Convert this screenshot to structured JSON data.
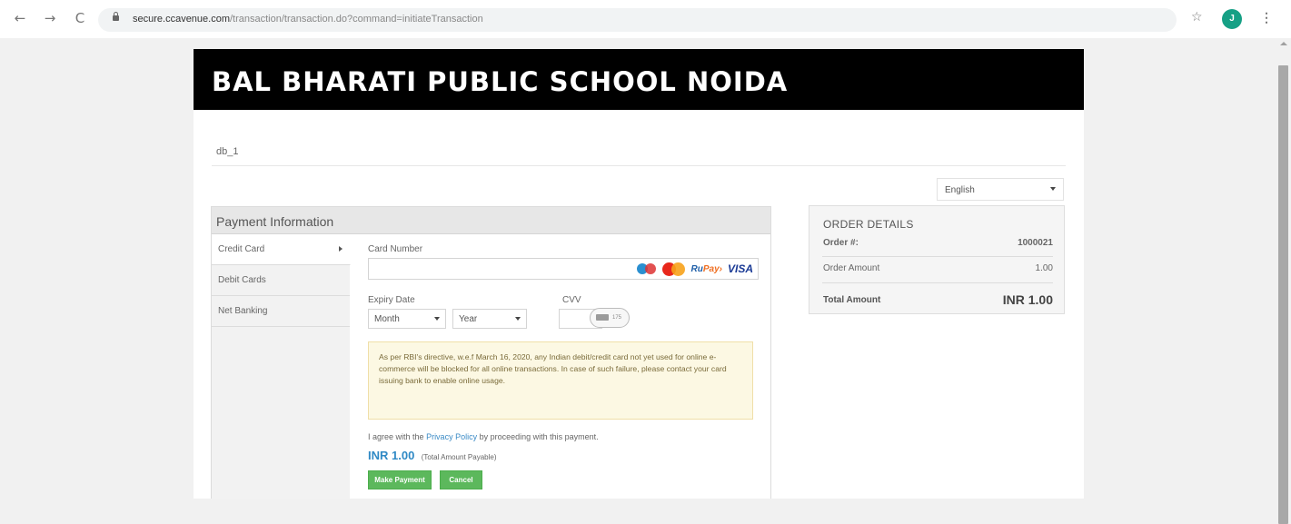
{
  "browser": {
    "url_host": "secure.ccavenue.com",
    "url_path": "/transaction/transaction.do?command=initiateTransaction",
    "avatar_initial": "J",
    "back_glyph": "←",
    "forward_glyph": "→",
    "reload_glyph": "C",
    "star_glyph": "☆",
    "menu_glyph": "⋮"
  },
  "header": {
    "school_name": "BAL BHARATI PUBLIC SCHOOL NOIDA"
  },
  "merchant": {
    "id": "db_1"
  },
  "language": {
    "selected": "English"
  },
  "payment": {
    "title": "Payment Information",
    "tabs": [
      {
        "label": "Credit Card",
        "active": true
      },
      {
        "label": "Debit Cards",
        "active": false
      },
      {
        "label": "Net Banking",
        "active": false
      }
    ],
    "card_number_label": "Card Number",
    "card_logos": {
      "rupay_prefix": "Ru",
      "rupay_suffix": "Pay",
      "rupay_arrow": "›",
      "visa": "VISA"
    },
    "expiry_label": "Expiry Date",
    "cvv_label": "CVV",
    "month_select": "Month",
    "year_select": "Year",
    "cvv_icon_text": "175",
    "notice": "As per RBI's directive, w.e.f March 16, 2020, any Indian debit/credit card not yet used for online e-commerce will be blocked for all online transactions. In case of such failure, please contact your card issuing bank to enable online usage.",
    "agree_prefix": "I agree with the",
    "privacy_link": "Privacy Policy",
    "agree_suffix": "by proceeding with this payment.",
    "amount": "INR 1.00",
    "amount_note": "(Total Amount Payable)",
    "make_payment_label": "Make Payment",
    "cancel_label": "Cancel"
  },
  "order": {
    "title": "ORDER DETAILS",
    "order_no_label": "Order #:",
    "order_no_value": "1000021",
    "order_amount_label": "Order Amount",
    "order_amount_value": "1.00",
    "total_label": "Total Amount",
    "total_value": "INR 1.00"
  },
  "colors": {
    "header_bg": "#000000",
    "button_green": "#5cb85c",
    "link_blue": "#3b8bc6",
    "notice_bg": "#fcf8e3"
  }
}
